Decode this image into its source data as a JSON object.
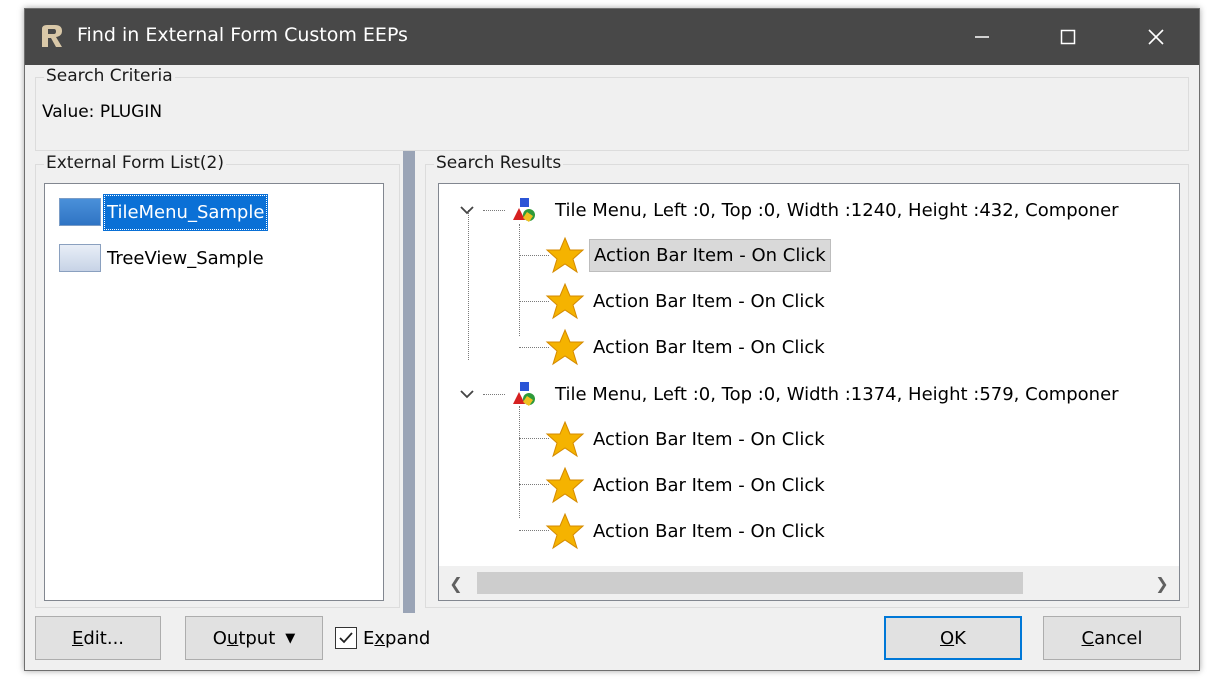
{
  "window": {
    "title": "Find in External Form Custom EEPs"
  },
  "search_criteria": {
    "label": "Search Criteria",
    "value_text": "Value: PLUGIN"
  },
  "form_list": {
    "label": "External Form List(2)",
    "items": [
      {
        "label": "TileMenu_Sample",
        "selected": true
      },
      {
        "label": "TreeView_Sample",
        "selected": false
      }
    ]
  },
  "search_results": {
    "label": "Search Results",
    "nodes": [
      {
        "label": "Tile Menu, Left :0, Top :0, Width :1240, Height :432, Componer",
        "expanded": true,
        "children": [
          {
            "label": "Action Bar Item - On Click",
            "focused": true
          },
          {
            "label": "Action Bar Item - On Click",
            "focused": false
          },
          {
            "label": "Action Bar Item - On Click",
            "focused": false
          }
        ]
      },
      {
        "label": "Tile Menu, Left :0, Top :0, Width :1374, Height :579, Componer",
        "expanded": true,
        "children": [
          {
            "label": "Action Bar Item - On Click",
            "focused": false
          },
          {
            "label": "Action Bar Item - On Click",
            "focused": false
          },
          {
            "label": "Action Bar Item - On Click",
            "focused": false
          }
        ]
      }
    ]
  },
  "buttons": {
    "edit": {
      "underline": "E",
      "rest": "dit..."
    },
    "output": {
      "pre": "O",
      "underline": "u",
      "rest": "tput"
    },
    "expand": {
      "pre": "E",
      "underline": "x",
      "rest": "pand",
      "checked": true
    },
    "ok": {
      "underline": "O",
      "rest": "K"
    },
    "cancel": {
      "underline": "C",
      "rest": "ancel"
    }
  },
  "icons": {
    "app": "app-logo-icon",
    "minimize": "minimize-icon",
    "maximize": "maximize-icon",
    "close": "close-icon",
    "form": "form-window-icon",
    "component": "component-shapes-icon",
    "event": "star-icon",
    "expand": "chevron-down-icon"
  },
  "colors": {
    "titlebar": "#484848",
    "selection": "#0a70d6",
    "default_button_border": "#0078d7",
    "star": "#f5b300"
  }
}
